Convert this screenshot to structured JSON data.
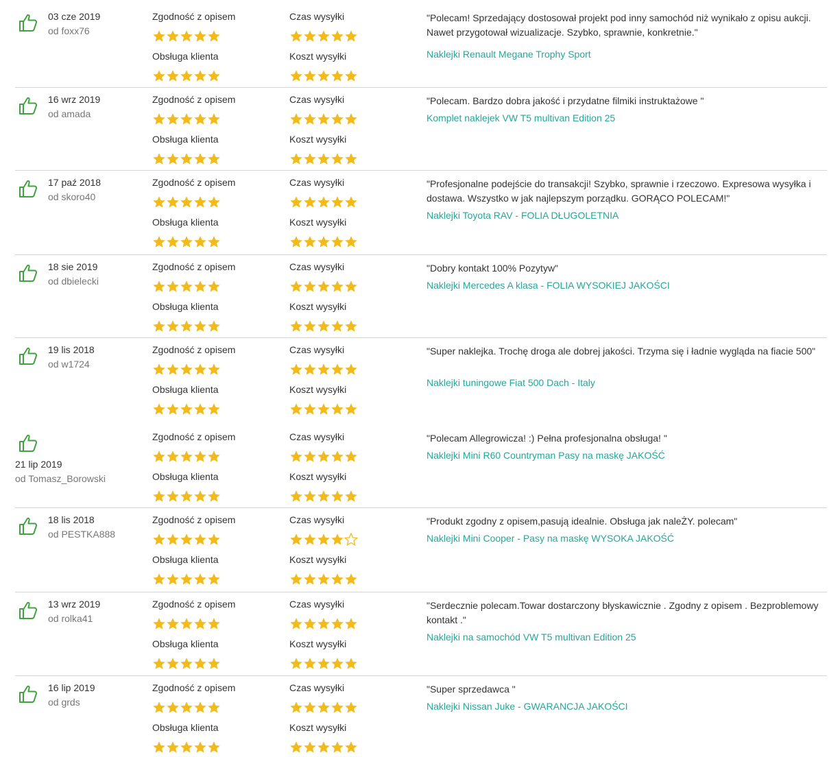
{
  "labels": {
    "accuracy": "Zgodność z opisem",
    "shipping_time": "Czas wysyłki",
    "service": "Obsługa klienta",
    "shipping_cost": "Koszt wysyłki"
  },
  "colors": {
    "star": "#f2bb1b",
    "thumb": "#3fa33f",
    "product_link": "#26a69a",
    "separator": "#d4d4d4"
  },
  "rating_max": 5,
  "reviews": [
    {
      "date": "03 cze 2019",
      "author": "od foxx76",
      "comment": "\"Polecam! Sprzedający dostosował projekt pod inny samochód niż wynikało z opisu aukcji. Nawet przygotował wizualizacje. Szybko, sprawnie, konkretnie.\"",
      "product": "Naklejki Renault Megane Trophy Sport",
      "ratings": {
        "accuracy": 5,
        "shipping_time": 5,
        "service": 5,
        "shipping_cost": 5
      },
      "icon": "thumbs-up-icon"
    },
    {
      "date": "16 wrz 2019",
      "author": "od amada",
      "comment": "\"Polecam. Bardzo dobra jakość i przydatne filmiki instruktażowe \"",
      "product": "Komplet naklejek VW T5 multivan Edition 25",
      "ratings": {
        "accuracy": 5,
        "shipping_time": 5,
        "service": 5,
        "shipping_cost": 5
      },
      "icon": "thumbs-up-icon"
    },
    {
      "date": "17 paź 2018",
      "author": "od skoro40",
      "comment": "\"Profesjonalne podejście do transakcji! Szybko, sprawnie i rzeczowo. Expresowa wysyłka i dostawa. Wszystko w jak najlepszym porządku. GORĄCO POLECAM!\"",
      "product": "Naklejki Toyota RAV - FOLIA DŁUGOLETNIA",
      "ratings": {
        "accuracy": 5,
        "shipping_time": 5,
        "service": 5,
        "shipping_cost": 5
      },
      "icon": "thumbs-up-icon"
    },
    {
      "date": "18 sie 2019",
      "author": "od dbielecki",
      "comment": "\"Dobry kontakt 100% Pozytyw\"",
      "product": "Naklejki Mercedes A klasa - FOLIA WYSOKIEJ JAKOŚCI",
      "ratings": {
        "accuracy": 5,
        "shipping_time": 5,
        "service": 5,
        "shipping_cost": 5
      },
      "icon": "thumbs-up-icon"
    },
    {
      "date": "19 lis 2018",
      "author": "od w1724",
      "comment": "\"Super naklejka. Trochę droga ale dobrej jakości. Trzyma się i ładnie wygląda na fiacie 500\"",
      "product": "Naklejki tuningowe Fiat 500 Dach - Italy",
      "ratings": {
        "accuracy": 5,
        "shipping_time": 5,
        "service": 5,
        "shipping_cost": 5
      },
      "icon": "thumbs-up-icon"
    },
    {
      "date": "21 lip 2019",
      "author": "od Tomasz_Borowski",
      "comment": "\"Polecam Allegrowicza! :) Pełna profesjonalna obsługa! \"",
      "product": "Naklejki Mini R60 Countryman Pasy na maskę JAKOŚĆ",
      "ratings": {
        "accuracy": 5,
        "shipping_time": 5,
        "service": 5,
        "shipping_cost": 5
      },
      "icon": "thumbs-up-icon"
    },
    {
      "date": "18 lis 2018",
      "author": "od PESTKA888",
      "comment": "\"Produkt zgodny z opisem,pasują idealnie. Obsługa jak naleŻY. polecam\"",
      "product": "Naklejki Mini Cooper - Pasy na maskę WYSOKA JAKOŚĆ",
      "ratings": {
        "accuracy": 5,
        "shipping_time": 4,
        "service": 5,
        "shipping_cost": 5
      },
      "icon": "thumbs-up-icon"
    },
    {
      "date": "13 wrz 2019",
      "author": "od rolka41",
      "comment": "\"Serdecznie polecam.Towar dostarczony błyskawicznie . Zgodny z opisem . Bezproblemowy kontakt .\"",
      "product": "Naklejki na samochód VW T5 multivan Edition 25",
      "ratings": {
        "accuracy": 5,
        "shipping_time": 5,
        "service": 5,
        "shipping_cost": 5
      },
      "icon": "thumbs-up-icon"
    },
    {
      "date": "16 lip 2019",
      "author": "od grds",
      "comment": "\"Super sprzedawca \"",
      "product": "Naklejki Nissan Juke - GWARANCJA JAKOŚCI",
      "ratings": {
        "accuracy": 5,
        "shipping_time": 5,
        "service": 5,
        "shipping_cost": 5
      },
      "icon": "thumbs-up-icon"
    }
  ]
}
